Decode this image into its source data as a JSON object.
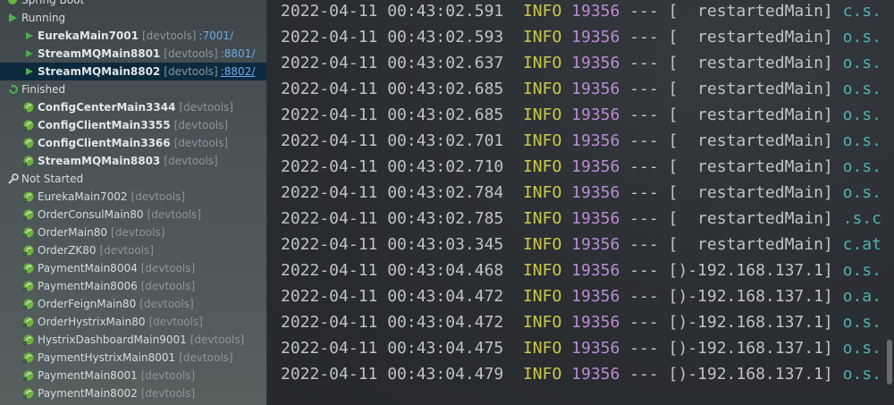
{
  "tree": {
    "root_label": "Spring Boot",
    "groups": [
      {
        "label": "Running",
        "icon": "run-icon",
        "items": [
          {
            "name": "EurekaMain7001",
            "tag": "[devtools]",
            "port": ":7001/",
            "selected": false
          },
          {
            "name": "StreamMQMain8801",
            "tag": "[devtools]",
            "port": ":8801/",
            "selected": false
          },
          {
            "name": "StreamMQMain8802",
            "tag": "[devtools]",
            "port": ":8802/",
            "selected": true
          }
        ]
      },
      {
        "label": "Finished",
        "icon": "finished-icon",
        "items": [
          {
            "name": "ConfigCenterMain3344",
            "tag": "[devtools]"
          },
          {
            "name": "ConfigClientMain3355",
            "tag": "[devtools]"
          },
          {
            "name": "ConfigClientMain3366",
            "tag": "[devtools]"
          },
          {
            "name": "StreamMQMain8803",
            "tag": "[devtools]"
          }
        ]
      },
      {
        "label": "Not Started",
        "icon": "wrench-icon",
        "items": [
          {
            "name": "EurekaMain7002",
            "tag": "[devtools]"
          },
          {
            "name": "OrderConsulMain80",
            "tag": "[devtools]"
          },
          {
            "name": "OrderMain80",
            "tag": "[devtools]"
          },
          {
            "name": "OrderZK80",
            "tag": "[devtools]"
          },
          {
            "name": "PaymentMain8004",
            "tag": "[devtools]"
          },
          {
            "name": "PaymentMain8006",
            "tag": "[devtools]"
          },
          {
            "name": "OrderFeignMain80",
            "tag": "[devtools]"
          },
          {
            "name": "OrderHystrixMain80",
            "tag": "[devtools]"
          },
          {
            "name": "HystrixDashboardMain9001",
            "tag": "[devtools]"
          },
          {
            "name": "PaymentHystrixMain8001",
            "tag": "[devtools]"
          },
          {
            "name": "PaymentMain8001",
            "tag": "[devtools]"
          },
          {
            "name": "PaymentMain8002",
            "tag": "[devtools]"
          }
        ]
      }
    ]
  },
  "console": {
    "lines": [
      {
        "datetime": "2022-04-11 00:43:02.591",
        "level": "INFO",
        "pid": "19356",
        "sep": "---",
        "thread": "[  restartedMain]",
        "cls": "c.s."
      },
      {
        "datetime": "2022-04-11 00:43:02.593",
        "level": "INFO",
        "pid": "19356",
        "sep": "---",
        "thread": "[  restartedMain]",
        "cls": "o.s."
      },
      {
        "datetime": "2022-04-11 00:43:02.637",
        "level": "INFO",
        "pid": "19356",
        "sep": "---",
        "thread": "[  restartedMain]",
        "cls": "o.s."
      },
      {
        "datetime": "2022-04-11 00:43:02.685",
        "level": "INFO",
        "pid": "19356",
        "sep": "---",
        "thread": "[  restartedMain]",
        "cls": "o.s."
      },
      {
        "datetime": "2022-04-11 00:43:02.685",
        "level": "INFO",
        "pid": "19356",
        "sep": "---",
        "thread": "[  restartedMain]",
        "cls": "o.s."
      },
      {
        "datetime": "2022-04-11 00:43:02.701",
        "level": "INFO",
        "pid": "19356",
        "sep": "---",
        "thread": "[  restartedMain]",
        "cls": "o.s."
      },
      {
        "datetime": "2022-04-11 00:43:02.710",
        "level": "INFO",
        "pid": "19356",
        "sep": "---",
        "thread": "[  restartedMain]",
        "cls": "o.s."
      },
      {
        "datetime": "2022-04-11 00:43:02.784",
        "level": "INFO",
        "pid": "19356",
        "sep": "---",
        "thread": "[  restartedMain]",
        "cls": "o.s."
      },
      {
        "datetime": "2022-04-11 00:43:02.785",
        "level": "INFO",
        "pid": "19356",
        "sep": "---",
        "thread": "[  restartedMain]",
        "cls": ".s.c"
      },
      {
        "datetime": "2022-04-11 00:43:03.345",
        "level": "INFO",
        "pid": "19356",
        "sep": "---",
        "thread": "[  restartedMain]",
        "cls": "c.at"
      },
      {
        "datetime": "2022-04-11 00:43:04.468",
        "level": "INFO",
        "pid": "19356",
        "sep": "---",
        "thread": "[)-192.168.137.1]",
        "cls": "o.s."
      },
      {
        "datetime": "2022-04-11 00:43:04.472",
        "level": "INFO",
        "pid": "19356",
        "sep": "---",
        "thread": "[)-192.168.137.1]",
        "cls": "o.a."
      },
      {
        "datetime": "2022-04-11 00:43:04.472",
        "level": "INFO",
        "pid": "19356",
        "sep": "---",
        "thread": "[)-192.168.137.1]",
        "cls": "o.s."
      },
      {
        "datetime": "2022-04-11 00:43:04.475",
        "level": "INFO",
        "pid": "19356",
        "sep": "---",
        "thread": "[)-192.168.137.1]",
        "cls": "o.s."
      },
      {
        "datetime": "2022-04-11 00:43:04.479",
        "level": "INFO",
        "pid": "19356",
        "sep": "---",
        "thread": "[)-192.168.137.1]",
        "cls": "o.s."
      }
    ]
  },
  "colors": {
    "selected_row": "#0d293e",
    "run_green": "#4caf50",
    "port_link": "#6fa9e6",
    "info_level": "#c9c94b",
    "pid": "#b98cd6",
    "logger": "#4fb2b2"
  }
}
